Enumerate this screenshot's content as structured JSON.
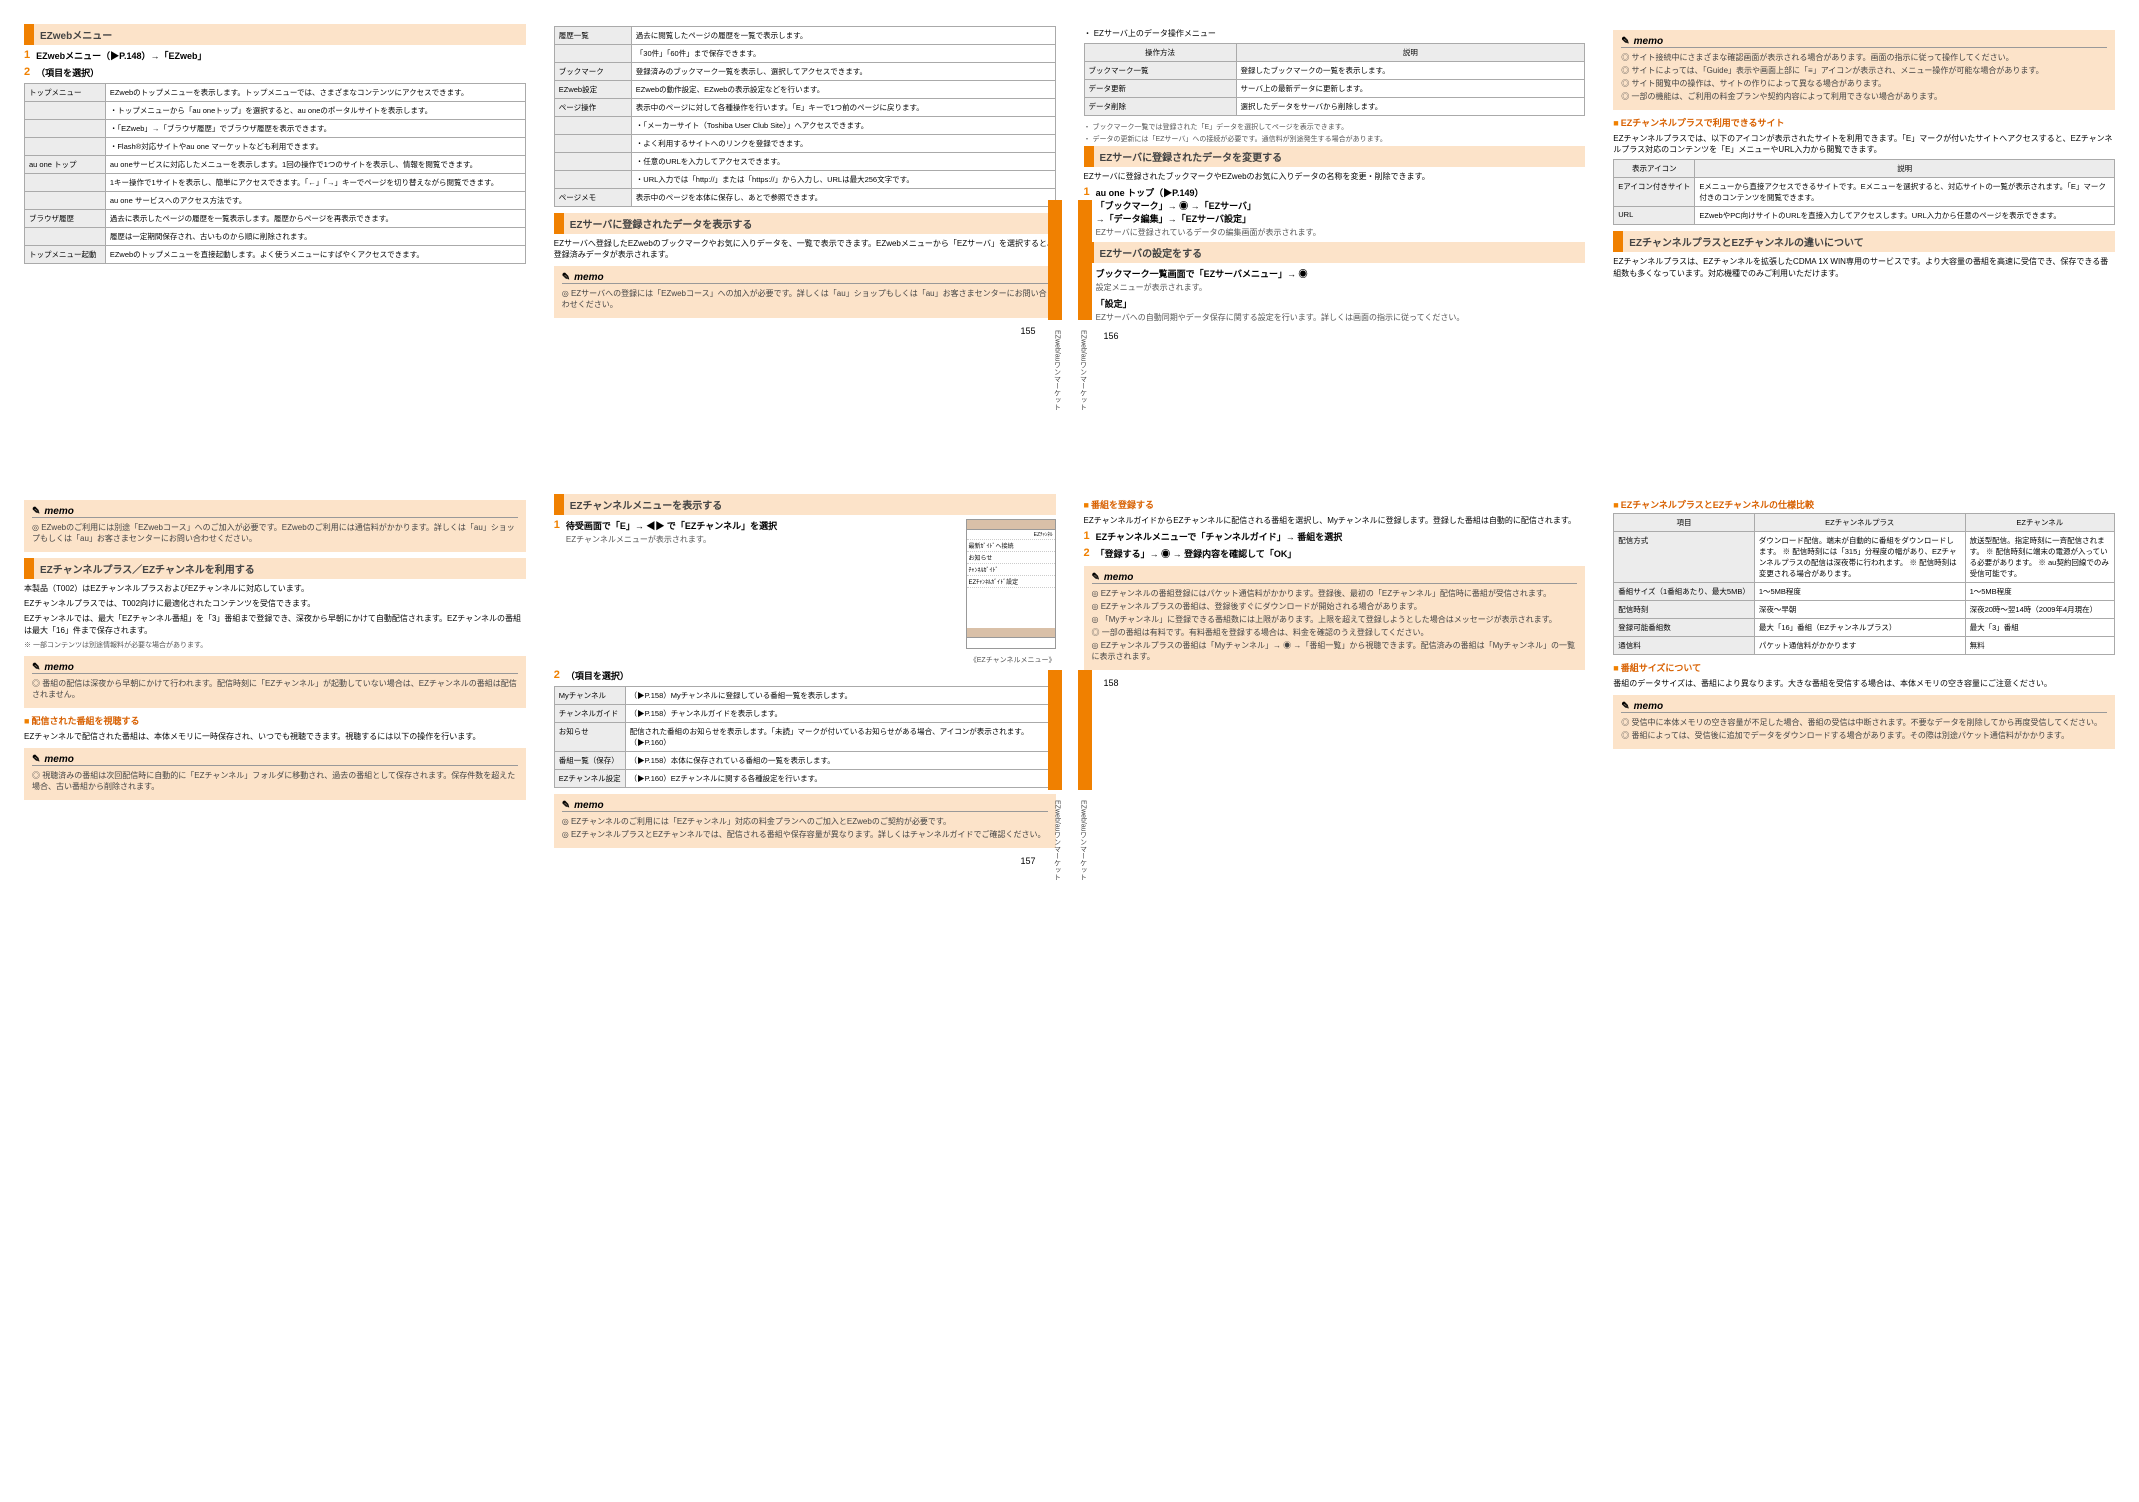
{
  "sidebar_label": "EZweb/auワンマーケット",
  "p155": {
    "head": "EZwebメニュー",
    "step1": "EZwebメニュー（▶P.148）→「EZweb」",
    "table1": [
      {
        "k": "トップメニュー",
        "v": "EZwebのトップメニューを表示します。トップメニューでは、さまざまなコンテンツにアクセスできます。"
      },
      {
        "k": "",
        "v": "・トップメニューから「au oneトップ」を選択すると、au oneのポータルサイトを表示します。"
      },
      {
        "k": "",
        "v": "・「EZweb」→「ブラウザ履歴」でブラウザ履歴を表示できます。"
      },
      {
        "k": "",
        "v": "・Flash®対応サイトやau one マーケットなども利用できます。"
      },
      {
        "k": "au one トップ",
        "v": "au oneサービスに対応したメニューを表示します。1回の操作で1つのサイトを表示し、情報を閲覧できます。"
      },
      {
        "k": "",
        "v": "1キー操作で1サイトを表示し、簡単にアクセスできます。「←」「→」キーでページを切り替えながら閲覧できます。"
      },
      {
        "k": "",
        "v": "au one サービスへのアクセス方法です。"
      },
      {
        "k": "ブラウザ履歴",
        "v": "過去に表示したページの履歴を一覧表示します。履歴からページを再表示できます。"
      },
      {
        "k": "",
        "v": "履歴は一定期間保存され、古いものから順に削除されます。"
      },
      {
        "k": "トップメニュー起動",
        "v": "EZwebのトップメニューを直接起動します。よく使うメニューにすばやくアクセスできます。"
      }
    ],
    "table2": [
      {
        "k": "履歴一覧",
        "v": "過去に閲覧したページの履歴を一覧で表示します。"
      },
      {
        "k": "",
        "v": "「30件」「60件」まで保存できます。"
      },
      {
        "k": "ブックマーク",
        "v": "登録済みのブックマーク一覧を表示し、選択してアクセスできます。"
      },
      {
        "k": "EZweb設定",
        "v": "EZwebの動作設定、EZwebの表示設定などを行います。"
      },
      {
        "k": "ページ操作",
        "v": "表示中のページに対して各種操作を行います。「E」キーで1つ前のページに戻ります。"
      },
      {
        "k": "",
        "v": "・「メーカーサイト（Toshiba User Club Site）」へアクセスできます。"
      },
      {
        "k": "",
        "v": "・よく利用するサイトへのリンクを登録できます。"
      },
      {
        "k": "",
        "v": "・任意のURLを入力してアクセスできます。"
      },
      {
        "k": "",
        "v": "・URL入力では「http://」または「https://」から入力し、URLは最大256文字です。"
      },
      {
        "k": "ページメモ",
        "v": "表示中のページを本体に保存し、あとで参照できます。"
      }
    ],
    "head2": "EZサーバに登録されたデータを表示する",
    "body2": "EZサーバへ登録したEZwebのブックマークやお気に入りデータを、一覧で表示できます。EZwebメニューから「EZサーバ」を選択すると、登録済みデータが表示されます。",
    "memo_items": [
      "EZサーバへの登録には「EZwebコース」への加入が必要です。詳しくは「au」ショップもしくは「au」お客さまセンターにお問い合わせください。"
    ],
    "page_num": "155"
  },
  "p156": {
    "table_upper_h": [
      "操作方法",
      "説明"
    ],
    "table_upper": [
      {
        "k": "ブックマーク一覧",
        "v": "登録したブックマークの一覧を表示します。"
      },
      {
        "k": "データ更新",
        "v": "サーバ上の最新データに更新します。"
      },
      {
        "k": "データ削除",
        "v": "選択したデータをサーバから削除します。"
      }
    ],
    "upper_notes": [
      "・ ブックマーク一覧では登録された「E」データを選択してページを表示できます。",
      "・ データの更新には「EZサーバ」への接続が必要です。通信料が別途発生する場合があります。"
    ],
    "head_change": "EZサーバに登録されたデータを変更する",
    "body_change": "EZサーバに登録されたブックマークやEZwebのお気に入りデータの名称を変更・削除できます。",
    "step_change_1": "au one トップ（▶P.149）",
    "step_change_2": "「ブックマーク」→ ◉ →「EZサーバ」",
    "step_change_3": "→「データ編集」→「EZサーバ設定」",
    "step_change_sub": "EZサーバに登録されているデータの編集画面が表示されます。",
    "head_disp": "EZサーバの設定をする",
    "step_disp_1": "ブックマーク一覧画面で「EZサーバメニュー」→ ◉",
    "step_disp_1_sub": "設定メニューが表示されます。",
    "step_disp_2": "「設定」",
    "step_disp_2_sub": "EZサーバへの自動同期やデータ保存に関する設定を行います。詳しくは画面の指示に従ってください。",
    "page_num": "156"
  },
  "p157a": {
    "memo_items": [
      "EZwebのご利用には別途「EZwebコース」へのご加入が必要です。EZwebのご利用には通信料がかかります。詳しくは「au」ショップもしくは「au」お客さまセンターにお問い合わせください。"
    ],
    "head_compat": "EZチャンネルプラス／EZチャンネルを利用する",
    "body_compat_1": "本製品（T002）はEZチャンネルプラスおよびEZチャンネルに対応しています。",
    "body_compat_2": "EZチャンネルプラスでは、T002向けに最適化されたコンテンツを受信できます。",
    "body_compat_3": "EZチャンネルでは、最大「EZチャンネル番組」を「3」番組まで登録でき、深夜から早朝にかけて自動配信されます。EZチャンネルの番組は最大「16」件まで保存されます。",
    "body_compat_note": "※ 一部コンテンツは別途情報料が必要な場合があります。",
    "memo2_items": [
      "番組の配信は深夜から早朝にかけて行われます。配信時刻に「EZチャンネル」が起動していない場合は、EZチャンネルの番組は配信されません。"
    ],
    "sub_deliver": "配信された番組を視聴する",
    "body_deliver": "EZチャンネルで配信された番組は、本体メモリに一時保存され、いつでも視聴できます。視聴するには以下の操作を行います。",
    "memo3_items": [
      "視聴済みの番組は次回配信時に自動的に「EZチャンネル」フォルダに移動され、過去の番組として保存されます。保存件数を超えた場合、古い番組から削除されます。"
    ]
  },
  "p157b": {
    "head_view": "EZチャンネルメニューを表示する",
    "step_view_1": "待受画面で「E」→ ◀▶ で「EZチャンネル」を選択",
    "step_view_1_sub": "EZチャンネルメニューが表示されます。",
    "screen_items": [
      "最新ｶﾞｲﾄﾞへ接続",
      "お知らせ",
      "ﾁｬﾝﾈﾙｶﾞｲﾄﾞ",
      "EZﾁｬﾝﾈﾙｶﾞｲﾄﾞ設定"
    ],
    "screen_caption": "《EZチャンネルメニュー》",
    "table_view": [
      {
        "k": "Myチャンネル",
        "v": "（▶P.158）Myチャンネルに登録している番組一覧を表示します。"
      },
      {
        "k": "チャンネルガイド",
        "v": "（▶P.158）チャンネルガイドを表示します。"
      },
      {
        "k": "お知らせ",
        "v": "配信された番組のお知らせを表示します。「未読」マークが付いているお知らせがある場合、アイコンが表示されます。（▶P.160）"
      },
      {
        "k": "番組一覧（保存）",
        "v": "（▶P.158）本体に保存されている番組の一覧を表示します。"
      },
      {
        "k": "EZチャンネル設定",
        "v": "（▶P.160）EZチャンネルに関する各種設定を行います。"
      }
    ],
    "memo_items": [
      "EZチャンネルのご利用には「EZチャンネル」対応の料金プランへのご加入とEZwebのご契約が必要です。",
      "EZチャンネルプラスとEZチャンネルでは、配信される番組や保存容量が異なります。詳しくはチャンネルガイドでご確認ください。"
    ],
    "page_num": "157"
  },
  "p158a": {
    "sub_ch": "番組を登録する",
    "body_ch_1": "EZチャンネルガイドからEZチャンネルに配信される番組を選択し、Myチャンネルに登録します。登録した番組は自動的に配信されます。",
    "step_ch_1": "EZチャンネルメニューで「チャンネルガイド」→ 番組を選択",
    "step_ch_2": "「登録する」→ ◉ → 登録内容を確認して「OK」",
    "memo_items": [
      "EZチャンネルの番組登録にはパケット通信料がかかります。登録後、最初の「EZチャンネル」配信時に番組が受信されます。",
      "EZチャンネルプラスの番組は、登録後すぐにダウンロードが開始される場合があります。",
      "「Myチャンネル」に登録できる番組数には上限があります。上限を超えて登録しようとした場合はメッセージが表示されます。",
      "一部の番組は有料です。有料番組を登録する場合は、料金を確認のうえ登録してください。",
      "EZチャンネルプラスの番組は「Myチャンネル」→ ◉ →「番組一覧」から視聴できます。配信済みの番組は「Myチャンネル」の一覧に表示されます。"
    ]
  },
  "p158b": {
    "memo_items": [
      "サイト接続中にさまざまな確認画面が表示される場合があります。画面の指示に従って操作してください。",
      "サイトによっては、「Guide」表示や画面上部に「≡」アイコンが表示され、メニュー操作が可能な場合があります。",
      "サイト閲覧中の操作は、サイトの作りによって異なる場合があります。",
      "一部の機能は、ご利用の料金プランや契約内容によって利用できない場合があります。"
    ],
    "sub_connect": "EZチャンネルプラスで利用できるサイト",
    "body_connect_1": "EZチャンネルプラスでは、以下のアイコンが表示されたサイトを利用できます。「E」マークが付いたサイトへアクセスすると、EZチャンネルプラス対応のコンテンツを「E」メニューやURL入力から閲覧できます。",
    "table_connect_h": [
      "表示アイコン",
      "説明"
    ],
    "table_connect": [
      {
        "k": "Eアイコン付きサイト",
        "v": "Eメニューから直接アクセスできるサイトです。Eメニューを選択すると、対応サイトの一覧が表示されます。「E」マーク付きのコンテンツを閲覧できます。"
      },
      {
        "k": "URL",
        "v": "EZwebやPC向けサイトのURLを直接入力してアクセスします。URL入力から任意のページを表示できます。"
      }
    ],
    "head_diff": "EZチャンネルプラスとEZチャンネルの違いについて",
    "body_diff": "EZチャンネルプラスは、EZチャンネルを拡張したCDMA 1X WIN専用のサービスです。より大容量の番組を高速に受信でき、保存できる番組数も多くなっています。対応機種でのみご利用いただけます。"
  },
  "p158c": {
    "sub_diff2": "EZチャンネルプラスとEZチャンネルの仕様比較",
    "table_diff_h": [
      "項目",
      "EZチャンネルプラス",
      "EZチャンネル"
    ],
    "table_diff": [
      {
        "k": "配信方式",
        "v1": "ダウンロード配信。端末が自動的に番組をダウンロードします。\n※ 配信時刻には「315」分程度の幅があり、EZチャンネルプラスの配信は深夜帯に行われます。\n※ 配信時刻は変更される場合があります。",
        "v2": "放送型配信。指定時刻に一斉配信されます。\n※ 配信時刻に端末の電源が入っている必要があります。\n※ au契約回線でのみ受信可能です。"
      },
      {
        "k": "番組サイズ（1番組あたり、最大5MB）",
        "v1": "1〜5MB程度",
        "v2": "1〜5MB程度"
      },
      {
        "k": "配信時刻",
        "v1": "深夜〜早朝",
        "v2": "深夜20時〜翌14時（2009年4月現在）"
      },
      {
        "k": "登録可能番組数",
        "v1": "最大「16」番組（EZチャンネルプラス）",
        "v2": "最大「3」番組"
      },
      {
        "k": "通信料",
        "v1": "パケット通信料がかかります",
        "v2": "無料"
      }
    ],
    "sub_size": "番組サイズについて",
    "body_size": "番組のデータサイズは、番組により異なります。大きな番組を受信する場合は、本体メモリの空き容量にご注意ください。",
    "memo_items": [
      "受信中に本体メモリの空き容量が不足した場合、番組の受信は中断されます。不要なデータを削除してから再度受信してください。",
      "番組によっては、受信後に追加でデータをダウンロードする場合があります。その際は別途パケット通信料がかかります。"
    ],
    "page_num": "158"
  }
}
